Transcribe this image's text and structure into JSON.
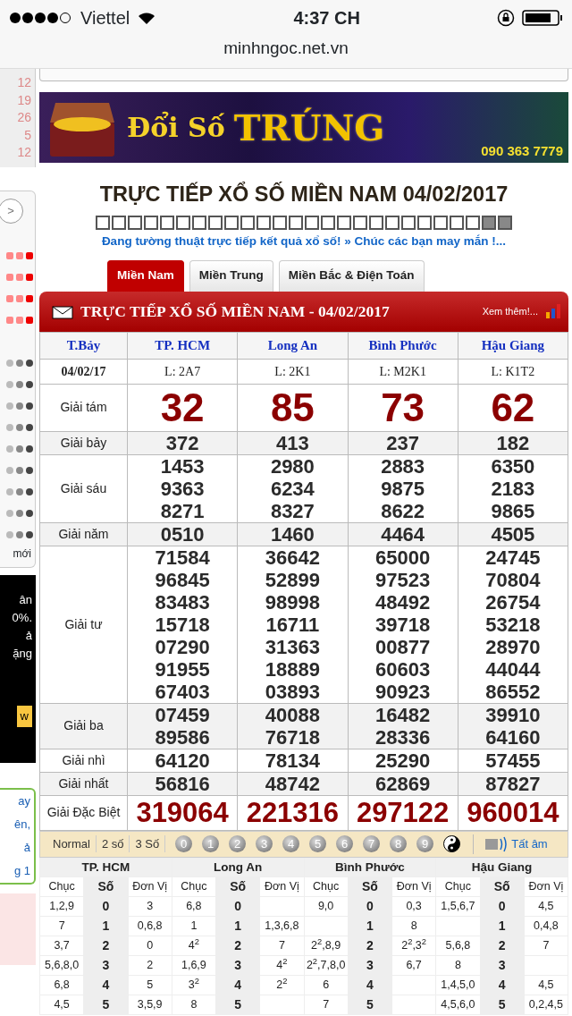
{
  "status_bar": {
    "carrier": "Viettel",
    "time": "4:37 CH"
  },
  "address_bar": {
    "url": "minhngoc.net.vn"
  },
  "sidebar": {
    "calendar_days": [
      "12",
      "19",
      "26",
      "5",
      "12"
    ],
    "next_button": ">",
    "new_label": "mới",
    "ad_lines": [
      "ân",
      "0%.",
      "ả",
      "ặng"
    ],
    "ad_button": "w",
    "links": [
      "ay",
      "ên,",
      "ả",
      "g 1"
    ]
  },
  "banner": {
    "headline": "Đổi Số",
    "highlight": "TRÚNG",
    "phone": "090 363 7779"
  },
  "title": "TRỰC TIẾP XỔ SỐ MIỀN NAM 04/02/2017",
  "progress_boxes": [
    false,
    false,
    false,
    false,
    false,
    false,
    false,
    false,
    false,
    false,
    false,
    false,
    false,
    false,
    false,
    false,
    false,
    false,
    false,
    false,
    false,
    false,
    false,
    false,
    true,
    true
  ],
  "ticker": "Đang tường thuật trực tiếp kết quả xổ số! » Chúc các bạn may mắn !...",
  "tabs": [
    {
      "label": "Miền Nam",
      "selected": true
    },
    {
      "label": "Miền Trung",
      "selected": false
    },
    {
      "label": "Miền Bắc & Điện Toán",
      "selected": false
    }
  ],
  "results": {
    "heading": "TRỰC TIẾP XỔ SỐ MIỀN NAM - 04/02/2017",
    "more_link": "Xem thêm!...",
    "day": "T.Bảy",
    "date": "04/02/17",
    "provinces": [
      {
        "name": "TP. HCM",
        "lot": "L: 2A7"
      },
      {
        "name": "Long An",
        "lot": "L: 2K1"
      },
      {
        "name": "Bình Phước",
        "lot": "L: M2K1"
      },
      {
        "name": "Hậu Giang",
        "lot": "L: K1T2"
      }
    ],
    "prizes": [
      {
        "label": "Giải tám",
        "kind": "big",
        "values": [
          [
            "32"
          ],
          [
            "85"
          ],
          [
            "73"
          ],
          [
            "62"
          ]
        ]
      },
      {
        "label": "Giải bảy",
        "kind": "normal",
        "values": [
          [
            "372"
          ],
          [
            "413"
          ],
          [
            "237"
          ],
          [
            "182"
          ]
        ]
      },
      {
        "label": "Giải sáu",
        "kind": "normal",
        "values": [
          [
            "1453",
            "9363",
            "8271"
          ],
          [
            "2980",
            "6234",
            "8327"
          ],
          [
            "2883",
            "9875",
            "8622"
          ],
          [
            "6350",
            "2183",
            "9865"
          ]
        ]
      },
      {
        "label": "Giải năm",
        "kind": "normal",
        "values": [
          [
            "0510"
          ],
          [
            "1460"
          ],
          [
            "4464"
          ],
          [
            "4505"
          ]
        ]
      },
      {
        "label": "Giải tư",
        "kind": "normal",
        "values": [
          [
            "71584",
            "96845",
            "83483",
            "15718",
            "07290",
            "91955",
            "67403"
          ],
          [
            "36642",
            "52899",
            "98998",
            "16711",
            "31363",
            "18889",
            "03893"
          ],
          [
            "65000",
            "97523",
            "48492",
            "39718",
            "00877",
            "60603",
            "90923"
          ],
          [
            "24745",
            "70804",
            "26754",
            "53218",
            "28970",
            "44044",
            "86552"
          ]
        ]
      },
      {
        "label": "Giải ba",
        "kind": "normal",
        "values": [
          [
            "07459",
            "89586"
          ],
          [
            "40088",
            "76718"
          ],
          [
            "16482",
            "28336"
          ],
          [
            "39910",
            "64160"
          ]
        ]
      },
      {
        "label": "Giải nhì",
        "kind": "normal",
        "values": [
          [
            "64120"
          ],
          [
            "78134"
          ],
          [
            "25290"
          ],
          [
            "57455"
          ]
        ]
      },
      {
        "label": "Giải nhất",
        "kind": "normal",
        "values": [
          [
            "56816"
          ],
          [
            "48742"
          ],
          [
            "62869"
          ],
          [
            "87827"
          ]
        ]
      },
      {
        "label": "Giải Đặc Biệt",
        "kind": "special",
        "values": [
          [
            "319064"
          ],
          [
            "221316"
          ],
          [
            "297122"
          ],
          [
            "960014"
          ]
        ]
      }
    ]
  },
  "toolbar": {
    "modes": [
      {
        "label": "Normal",
        "selected": false
      },
      {
        "label": "2 số",
        "selected": false
      },
      {
        "label": "3 Số",
        "selected": false
      }
    ],
    "digits": [
      "0",
      "1",
      "2",
      "3",
      "4",
      "5",
      "6",
      "7",
      "8",
      "9"
    ],
    "mute_link": "Tất âm"
  },
  "loto": [
    {
      "province": "TP. HCM",
      "headers": [
        "Chục",
        "Số",
        "Đơn Vị"
      ],
      "rows": [
        {
          "tens": "1,2,9",
          "digit": "0",
          "units": "3"
        },
        {
          "tens": "7",
          "digit": "1",
          "units": "0,6,8"
        },
        {
          "tens": "3,7",
          "digit": "2",
          "units": "0"
        },
        {
          "tens": "5,6,8,0",
          "digit": "3",
          "units": "2"
        },
        {
          "tens": "6,8",
          "digit": "4",
          "units": "5"
        },
        {
          "tens": "4,5",
          "digit": "5",
          "units": "3,5,9"
        }
      ]
    },
    {
      "province": "Long An",
      "headers": [
        "Chục",
        "Số",
        "Đơn Vị"
      ],
      "rows": [
        {
          "tens": "6,8",
          "digit": "0"
        },
        {
          "tens": "1",
          "digit": "1",
          "units": "1,3,6,8"
        },
        {
          "tens": "4$^{2}$",
          "digit": "2",
          "units": "7"
        },
        {
          "tens": "1,6,9",
          "digit": "3",
          "units": "4$^{2}$"
        },
        {
          "tens": "3$^{2}$",
          "digit": "4",
          "units": "2$^{2}$"
        },
        {
          "tens": "8",
          "digit": "5"
        }
      ]
    },
    {
      "province": "Bình Phước",
      "headers": [
        "Chục",
        "Số",
        "Đơn Vị"
      ],
      "rows": [
        {
          "tens": "9,0",
          "digit": "0",
          "units": "0,3"
        },
        {
          "digit": "1",
          "units": "8"
        },
        {
          "tens": "2$^{2}$,8,9",
          "digit": "2",
          "units": "2$^{2}$,3$^{2}$"
        },
        {
          "tens": "2$^{2}$,7,8,0",
          "digit": "3",
          "units": "6,7"
        },
        {
          "tens": "6",
          "digit": "4"
        },
        {
          "tens": "7",
          "digit": "5"
        }
      ]
    },
    {
      "province": "Hậu Giang",
      "headers": [
        "Chục",
        "Số",
        "Đơn Vị"
      ],
      "rows": [
        {
          "tens": "1,5,6,7",
          "digit": "0",
          "units": "4,5"
        },
        {
          "digit": "1",
          "units": "0,4,8"
        },
        {
          "tens": "5,6,8",
          "digit": "2",
          "units": "7"
        },
        {
          "tens": "8",
          "digit": "3"
        },
        {
          "tens": "1,4,5,0",
          "digit": "4",
          "units": "4,5"
        },
        {
          "tens": "4,5,6,0",
          "digit": "5",
          "units": "0,2,4,5"
        }
      ]
    }
  ]
}
